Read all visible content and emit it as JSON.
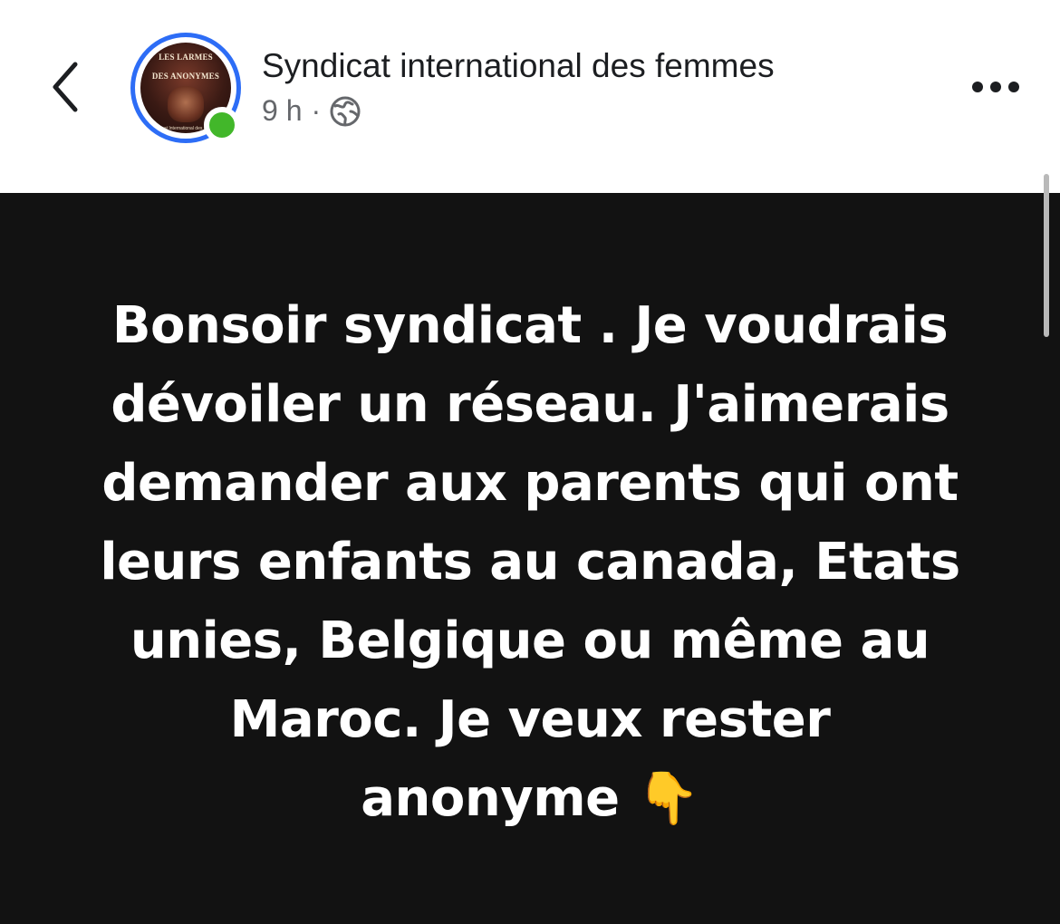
{
  "header": {
    "page_name": "Syndicat international des femmes",
    "time": "9 h",
    "separator": "·",
    "privacy_icon": "globe-icon",
    "back_icon": "chevron-left-icon",
    "more_icon": "more-horizontal-icon",
    "online_status_color": "#42b72a",
    "story_ring_color": "#2d6df6"
  },
  "avatar": {
    "title_line1": "LES LARMES",
    "title_line2": "DES ANONYMES",
    "subtitle": "Syndicat International des Femmes"
  },
  "post": {
    "background_color": "#121212",
    "text_lines": [
      "Bonsoir syndicat . Je voudrais",
      "dévoiler un réseau.  J'aimerais",
      "demander aux parents qui ont",
      "leurs enfants au canada,  Etats",
      "unies,  Belgique ou même au",
      "Maroc. Je veux rester",
      "anonyme "
    ],
    "emoji": "👇"
  }
}
